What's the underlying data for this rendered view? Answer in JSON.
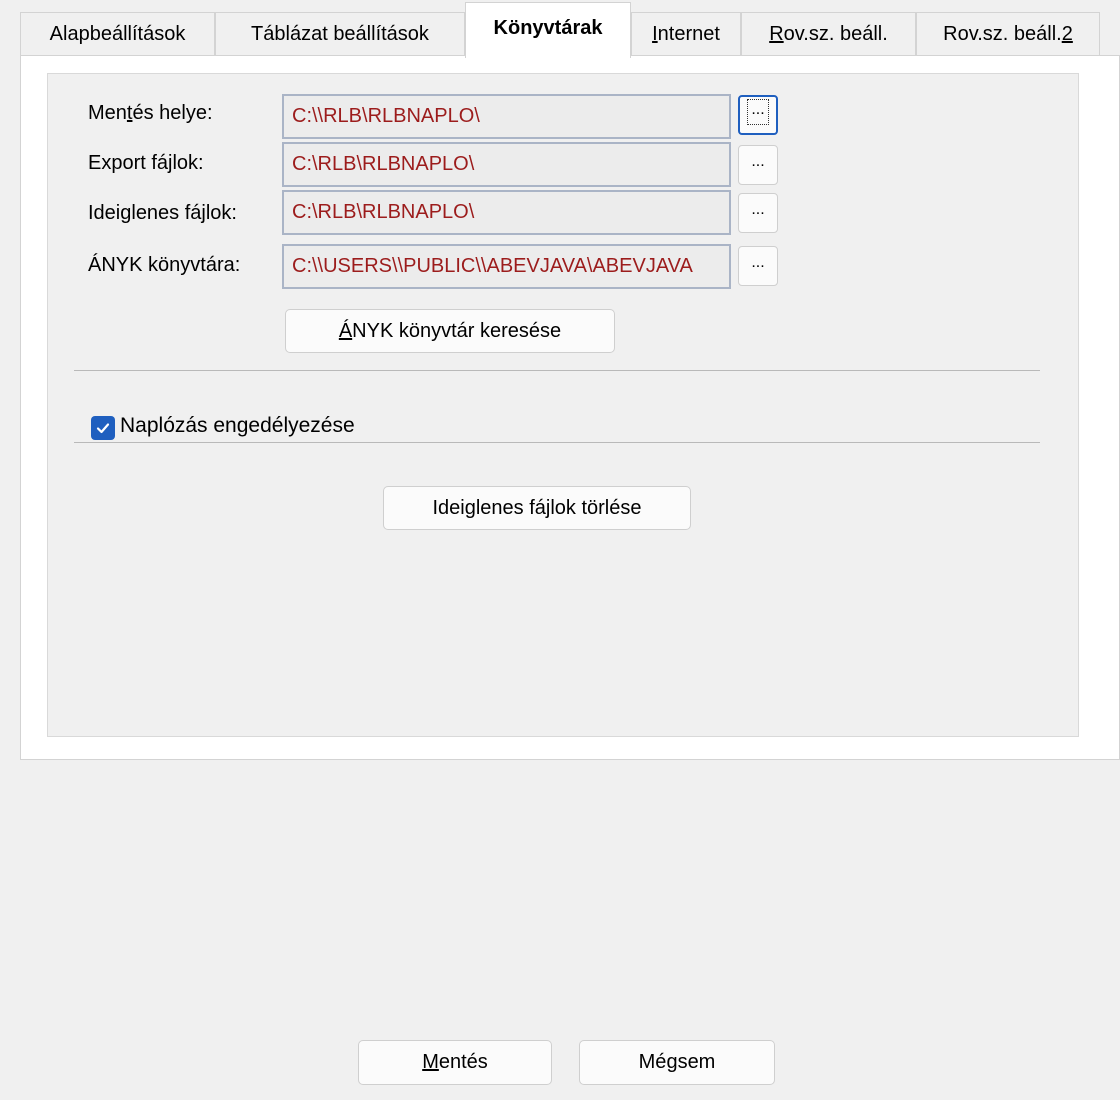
{
  "tabs": [
    {
      "label": "Alapbeállítások",
      "active": false
    },
    {
      "label": "Táblázat beállítások",
      "active": false
    },
    {
      "label": "Könyvtárak",
      "active": true
    },
    {
      "label": "Internet",
      "active": false
    },
    {
      "label": "Rov.sz. beáll.",
      "active": false
    },
    {
      "label": "Rov.sz. beáll.2",
      "active": false
    }
  ],
  "directories": [
    {
      "label": "Mentés helye:",
      "path": "C:\\\\RLB\\RLBNAPLO\\",
      "browse_label": "..."
    },
    {
      "label": "Export fájlok:",
      "path": "C:\\RLB\\RLBNAPLO\\",
      "browse_label": "..."
    },
    {
      "label": "Ideiglenes fájlok:",
      "path": "C:\\RLB\\RLBNAPLO\\",
      "browse_label": "..."
    },
    {
      "label": "ÁNYK könyvtára:",
      "path": "C:\\\\USERS\\\\PUBLIC\\\\ABEVJAVA\\ABEVJAVA",
      "browse_label": "..."
    }
  ],
  "anyk_search_button": "ÁNYK könyvtár keresése",
  "logging": {
    "label": "Naplózás engedélyezése",
    "checked": true
  },
  "clear_temp_button": "Ideiglenes fájlok törlése",
  "footer": {
    "save_label": "Mentés",
    "cancel_label": "Mégsem"
  },
  "colors": {
    "accent": "#1f5fbf",
    "path_text": "#9c1c1c"
  }
}
